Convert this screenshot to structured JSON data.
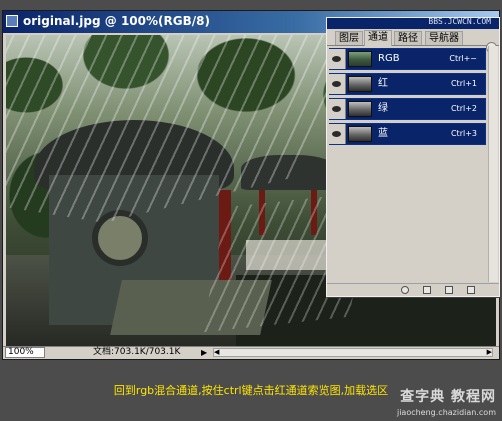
{
  "document": {
    "title": "original.jpg @ 100%(RGB/8)",
    "zoom": "100%",
    "doc_size": "文档:703.1K/703.1K"
  },
  "channels_panel": {
    "site_label": "BBS.JCWCN.COM",
    "tabs": [
      "图层",
      "通道",
      "路径",
      "导航器"
    ],
    "active_tab": "通道",
    "channels": [
      {
        "name": "RGB",
        "shortcut": "Ctrl+~",
        "thumb": "rgb"
      },
      {
        "name": "红",
        "shortcut": "Ctrl+1",
        "thumb": "gray"
      },
      {
        "name": "绿",
        "shortcut": "Ctrl+2",
        "thumb": "gray"
      },
      {
        "name": "蓝",
        "shortcut": "Ctrl+3",
        "thumb": "gray"
      }
    ]
  },
  "caption": "回到rgb混合通道,按住ctrl键点击红通道索览图,加载选区",
  "watermark": {
    "logo": "查字典 教程网",
    "url": "jiaocheng.chazidian.com"
  },
  "colors": {
    "selection": "#0a246a",
    "caption": "#ffe600"
  }
}
